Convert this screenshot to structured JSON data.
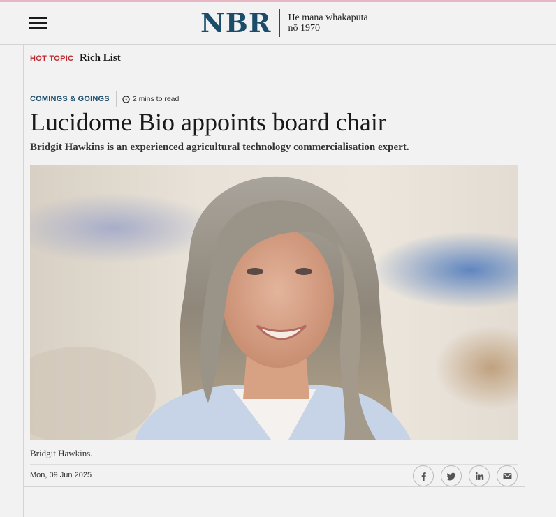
{
  "header": {
    "logo": "NBR",
    "tagline_line1": "He mana whakaputa",
    "tagline_line2": "nō 1970",
    "menu_icon": "hamburger-menu-icon"
  },
  "topic_bar": {
    "label": "HOT TOPIC",
    "link": "Rich List"
  },
  "article": {
    "category": "COMINGS & GOINGS",
    "read_time": "2 mins to read",
    "title": "Lucidome Bio appoints board chair",
    "standfirst": "Bridgit Hawkins is an experienced agricultural technology commercialisation expert.",
    "caption": "Bridgit Hawkins.",
    "date": "Mon, 09 Jun 2025"
  },
  "share": [
    {
      "icon": "facebook-icon"
    },
    {
      "icon": "twitter-icon"
    },
    {
      "icon": "linkedin-icon"
    },
    {
      "icon": "email-icon"
    }
  ],
  "colors": {
    "brand": "#1b4d6a",
    "hot_topic": "#c0272d",
    "background": "#f2f2f2",
    "top_accent": "#e7b7c6"
  }
}
